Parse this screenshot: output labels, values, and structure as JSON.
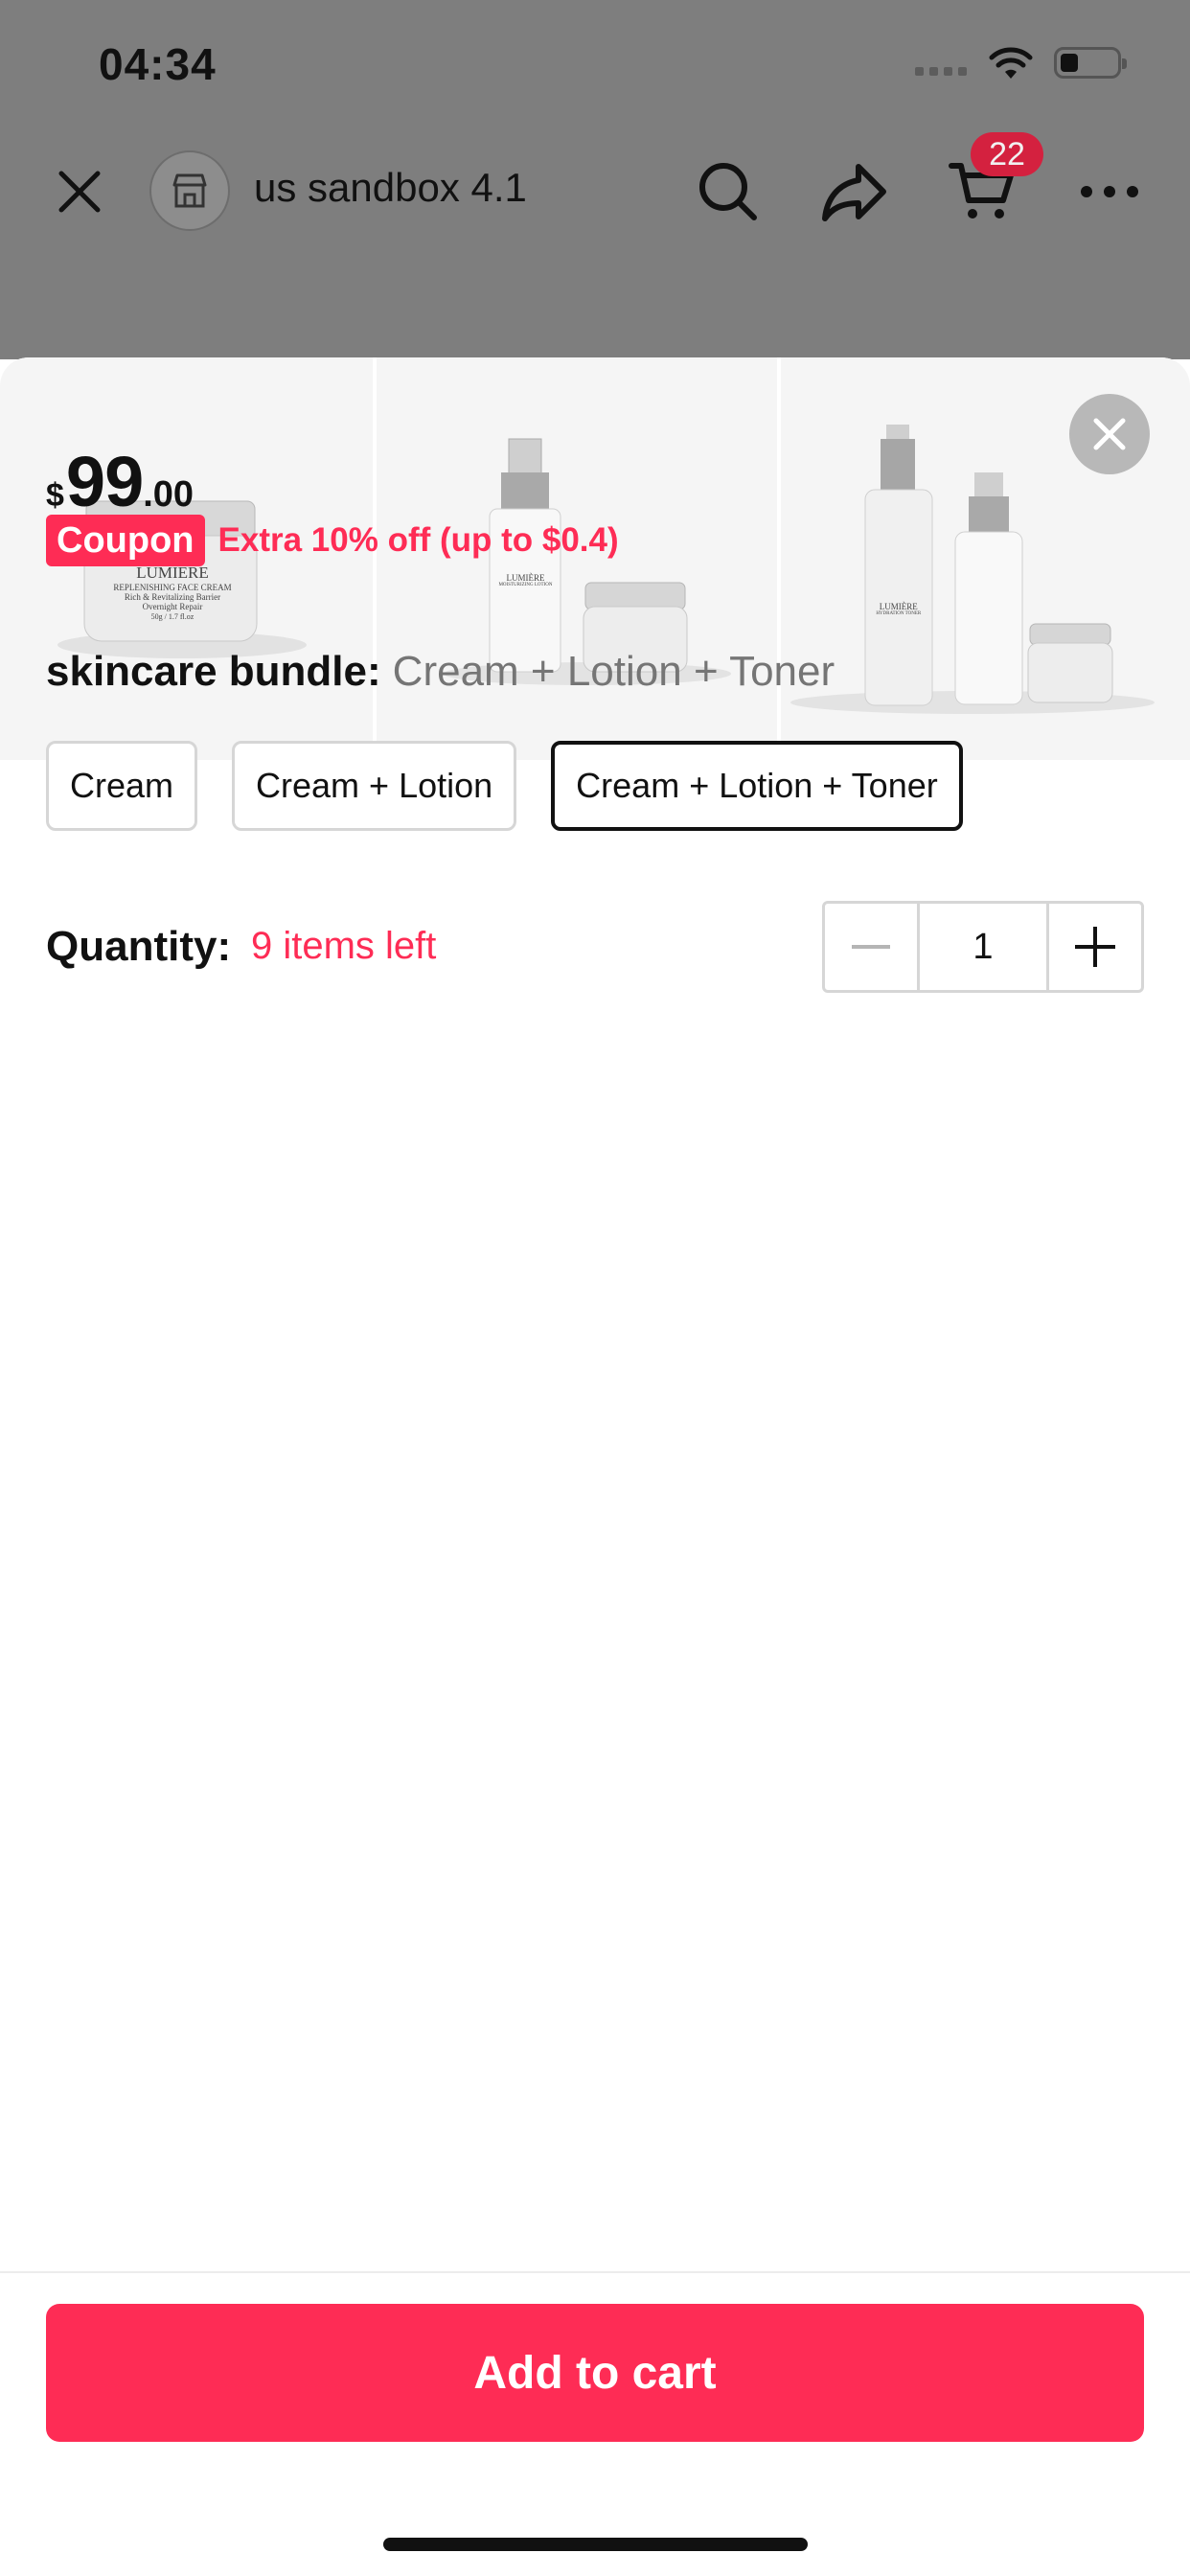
{
  "status_bar": {
    "time": "04:34"
  },
  "header": {
    "shop_name": "us sandbox 4.1",
    "cart_count": "22",
    "icons": [
      "close-icon",
      "store-icon",
      "search-icon",
      "share-icon",
      "cart-icon",
      "more-icon"
    ]
  },
  "gallery": {
    "images": [
      {
        "brand": "LUMIÈRE",
        "line1": "REPLENISHING FACE CREAM",
        "line2": "Rich & Revitalizing Barrier",
        "line3": "Overnight Repair",
        "line4": "50g / 1.7 fl.oz"
      },
      {
        "brand": "LUMIÈRE",
        "line1": "MOISTURIZING LOTION"
      },
      {
        "brand": "LUMIÈRE",
        "line1": "HYDRATION TONER"
      }
    ]
  },
  "product": {
    "price": {
      "currency": "$",
      "integer": "99",
      "decimal": ".00"
    },
    "coupon": {
      "tag": "Coupon",
      "text": "Extra 10% off (up to $0.4)"
    },
    "variant": {
      "label": "skincare bundle:",
      "selected_value": "Cream + Lotion + Toner",
      "options": [
        "Cream",
        "Cream + Lotion",
        "Cream + Lotion + Toner"
      ]
    },
    "quantity": {
      "label": "Quantity:",
      "stock": "9 items left",
      "value": "1"
    }
  },
  "footer": {
    "add_to_cart": "Add to cart"
  },
  "colors": {
    "accent": "#fe2c55",
    "badge": "#d4213f",
    "backdrop": "#7e7e7e"
  }
}
